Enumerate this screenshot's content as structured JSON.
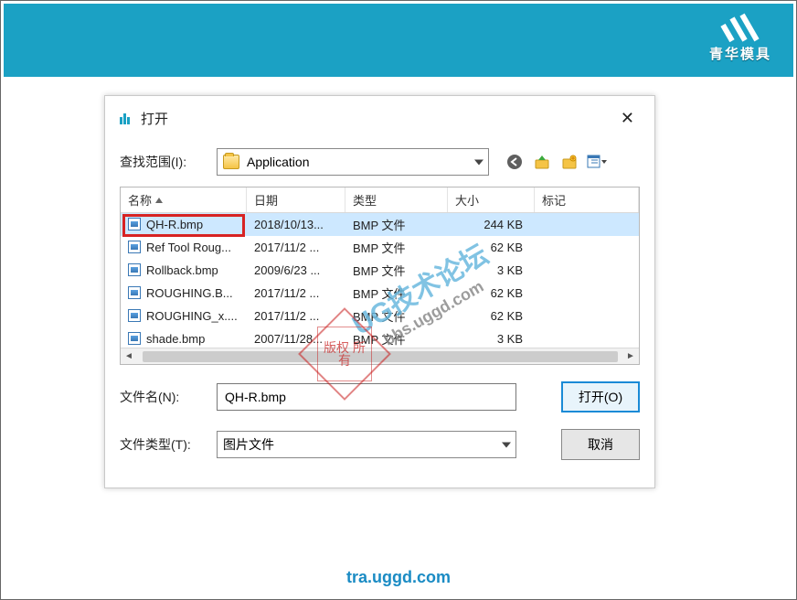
{
  "banner": {
    "brand": "青华模具"
  },
  "dialog": {
    "title_label": "打开",
    "lookin_label": "查找范围(I):",
    "lookin_value": "Application",
    "columns": {
      "name": "名称",
      "date": "日期",
      "type": "类型",
      "size": "大小",
      "tag": "标记"
    },
    "rows": [
      {
        "name": "QH-R.bmp",
        "date": "2018/10/13...",
        "type": "BMP 文件",
        "size": "244 KB",
        "selected": true
      },
      {
        "name": "Ref Tool Roug...",
        "date": "2017/11/2 ...",
        "type": "BMP 文件",
        "size": "62 KB"
      },
      {
        "name": "Rollback.bmp",
        "date": "2009/6/23 ...",
        "type": "BMP 文件",
        "size": "3 KB"
      },
      {
        "name": "ROUGHING.B...",
        "date": "2017/11/2 ...",
        "type": "BMP 文件",
        "size": "62 KB"
      },
      {
        "name": "ROUGHING_x....",
        "date": "2017/11/2 ...",
        "type": "BMP 文件",
        "size": "62 KB"
      },
      {
        "name": "shade.bmp",
        "date": "2007/11/28...",
        "type": "BMP 文件",
        "size": "3 KB"
      }
    ],
    "filename_label": "文件名(N):",
    "filename_value": "QH-R.bmp",
    "filetype_label": "文件类型(T):",
    "filetype_value": "图片文件",
    "open_btn": "打开(O)",
    "cancel_btn": "取消"
  },
  "watermark": {
    "line1": "UG技术论坛",
    "line2": "bbs.uggd.com"
  },
  "stamp_text": "版权\n所有",
  "footer": "tra.uggd.com"
}
